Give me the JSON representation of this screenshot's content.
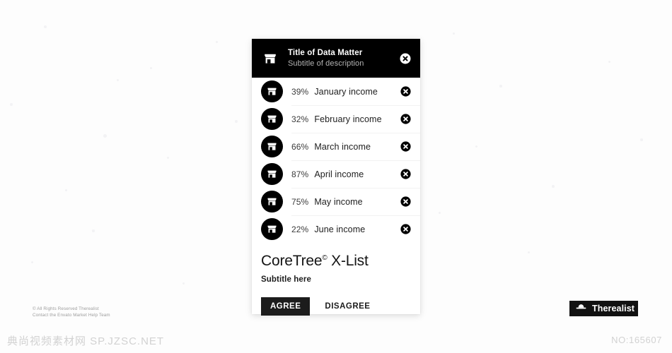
{
  "colors": {
    "background": "#fdfdfd",
    "card_background": "#ffffff",
    "header_background": "#000000",
    "accent_black": "#1c1c1c",
    "subtitle_gray": "#b4b4b4",
    "divider": "#f2f2f2",
    "watermark_gray": "#d2d2d2"
  },
  "card": {
    "header": {
      "icon": "store-icon",
      "title": "Title of Data Matter",
      "subtitle": "Subtitle of description",
      "close_icon": "close-circle-icon"
    },
    "rows": [
      {
        "icon": "store-icon",
        "percent": "39%",
        "label": "January income",
        "close_icon": "close-circle-icon"
      },
      {
        "icon": "store-icon",
        "percent": "32%",
        "label": "February income",
        "close_icon": "close-circle-icon"
      },
      {
        "icon": "store-icon",
        "percent": "66%",
        "label": "March income",
        "close_icon": "close-circle-icon"
      },
      {
        "icon": "store-icon",
        "percent": "87%",
        "label": "April income",
        "close_icon": "close-circle-icon"
      },
      {
        "icon": "store-icon",
        "percent": "75%",
        "label": "May income",
        "close_icon": "close-circle-icon"
      },
      {
        "icon": "store-icon",
        "percent": "22%",
        "label": "June income",
        "close_icon": "close-circle-icon"
      }
    ],
    "footer": {
      "title_main": "CoreTree",
      "title_sup": "©",
      "title_tail": " X-List",
      "subtitle": "Subtitle here",
      "agree_label": "AGREE",
      "disagree_label": "DISAGREE"
    }
  },
  "page": {
    "credits_line1": "© All Rights Reserved Therealist",
    "credits_line2": "Contact the Envato Market Help Team",
    "brand_badge": {
      "icon": "bowler-hat-icon",
      "label": "Therealist"
    },
    "watermark_left": "典尚视频素材网 SP.JZSC.NET",
    "watermark_right": "NO:165607"
  }
}
